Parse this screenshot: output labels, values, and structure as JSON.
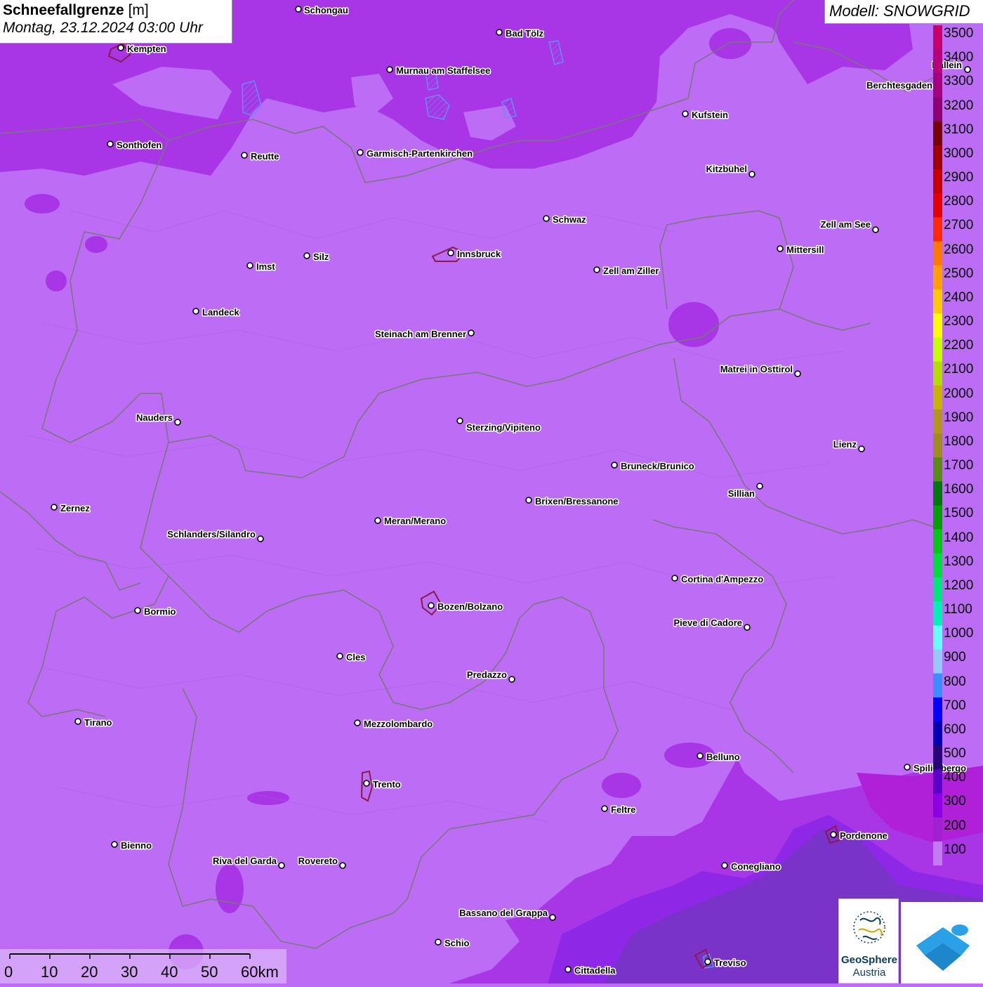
{
  "title": {
    "main": "Schneefallgrenze",
    "unit": "[m]",
    "datetime": "Montag, 23.12.2024 03:00 Uhr"
  },
  "model_label": "Modell: SNOWGRID",
  "legend": {
    "labels": [
      "3500",
      "3400",
      "3300",
      "3200",
      "3100",
      "3000",
      "2900",
      "2800",
      "2700",
      "2600",
      "2500",
      "2400",
      "2300",
      "2200",
      "2100",
      "2000",
      "1900",
      "1800",
      "1700",
      "1600",
      "1500",
      "1400",
      "1300",
      "1200",
      "1100",
      "1000",
      "900",
      "800",
      "700",
      "600",
      "500",
      "400",
      "300",
      "200",
      "100"
    ],
    "colors": [
      "#c8006e",
      "#b8007a",
      "#a40080",
      "#8c0073",
      "#780000",
      "#a00000",
      "#c80000",
      "#e60000",
      "#ff2a00",
      "#ff7800",
      "#ffa000",
      "#ffc800",
      "#ffff00",
      "#c8ff00",
      "#b4dc00",
      "#c8b400",
      "#b4961e",
      "#a08c1e",
      "#5a8c14",
      "#00780a",
      "#00a000",
      "#00c814",
      "#00dc3c",
      "#00e67a",
      "#00f0b4",
      "#64ffff",
      "#96c8ff",
      "#3c8cff",
      "#0000ff",
      "#0000b4",
      "#280078",
      "#5a00c8",
      "#8c00e6",
      "#a020d2",
      "#c27af0"
    ]
  },
  "scalebar": {
    "ticks": [
      "0",
      "10",
      "20",
      "30",
      "40",
      "50",
      "60km"
    ]
  },
  "logos": {
    "geosphere_line1": "GeoSphere",
    "geosphere_line2": "Austria"
  },
  "cities": [
    {
      "name": "Schongau"
    },
    {
      "name": "Bad Tölz"
    },
    {
      "name": "Kempten"
    },
    {
      "name": "Murnau am Staffelsee"
    },
    {
      "name": "Hallein"
    },
    {
      "name": "Berchtesgaden"
    },
    {
      "name": "Kufstein"
    },
    {
      "name": "Sonthofen"
    },
    {
      "name": "Reutte"
    },
    {
      "name": "Garmisch-Partenkirchen"
    },
    {
      "name": "Kitzbühel"
    },
    {
      "name": "Schwaz"
    },
    {
      "name": "Zell am See"
    },
    {
      "name": "Mittersill"
    },
    {
      "name": "Innsbruck"
    },
    {
      "name": "Imst"
    },
    {
      "name": "Silz"
    },
    {
      "name": "Zell am Ziller"
    },
    {
      "name": "Landeck"
    },
    {
      "name": "Steinach am Brenner"
    },
    {
      "name": "Matrei in Osttirol"
    },
    {
      "name": "Nauders"
    },
    {
      "name": "Sterzing/Vipiteno"
    },
    {
      "name": "Lienz"
    },
    {
      "name": "Bruneck/Brunico"
    },
    {
      "name": "Sillian"
    },
    {
      "name": "Zernez"
    },
    {
      "name": "Brixen/Bressanone"
    },
    {
      "name": "Meran/Merano"
    },
    {
      "name": "Schlanders/Silandro"
    },
    {
      "name": "Cortina d'Ampezzo"
    },
    {
      "name": "Bormio"
    },
    {
      "name": "Bozen/Bolzano"
    },
    {
      "name": "Pieve di Cadore"
    },
    {
      "name": "Cles"
    },
    {
      "name": "Predazzo"
    },
    {
      "name": "Tirano"
    },
    {
      "name": "Mezzolombardo"
    },
    {
      "name": "Belluno"
    },
    {
      "name": "Spilimbergo"
    },
    {
      "name": "Trento"
    },
    {
      "name": "Feltre"
    },
    {
      "name": "Pordenone"
    },
    {
      "name": "Bienno"
    },
    {
      "name": "Riva del Garda"
    },
    {
      "name": "Rovereto"
    },
    {
      "name": "Conegliano"
    },
    {
      "name": "Bassano del Grappa"
    },
    {
      "name": "Schio"
    },
    {
      "name": "Treviso"
    },
    {
      "name": "Cittadella"
    }
  ]
}
